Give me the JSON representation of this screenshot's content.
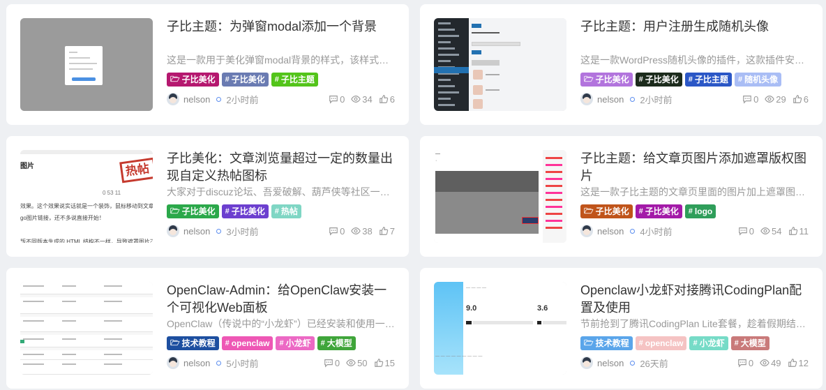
{
  "cards": [
    {
      "title": "子比主题：为弹窗modal添加一个背景",
      "excerpt": "这是一款用于美化弹窗modal背景的样式，该样式可以让弹窗更加美观。",
      "tags": [
        {
          "label": "子比美化",
          "color": "#b5186f",
          "icon": "folder-icon"
        },
        {
          "label": "子比美化",
          "color": "#6a7bb2",
          "icon": "hash-icon"
        },
        {
          "label": "子比主题",
          "color": "#53c41a",
          "icon": "hash-icon"
        }
      ],
      "author": "nelson",
      "time": "2小时前",
      "comments": "0",
      "views": "34",
      "likes": "6"
    },
    {
      "title": "子比主题：用户注册生成随机头像",
      "excerpt": "这是一款WordPress随机头像的插件，这款插件安装后用户注册时会随机分配头像。",
      "tags": [
        {
          "label": "子比美化",
          "color": "#b274dd",
          "icon": "folder-icon"
        },
        {
          "label": "子比美化",
          "color": "#1c2b1c",
          "icon": "hash-icon"
        },
        {
          "label": "子比主题",
          "color": "#2b57c6",
          "icon": "hash-icon"
        },
        {
          "label": "随机头像",
          "color": "#a9bdf5",
          "icon": "hash-icon"
        }
      ],
      "author": "nelson",
      "time": "2小时前",
      "comments": "0",
      "views": "29",
      "likes": "6"
    },
    {
      "title": "子比美化：文章浏览量超过一定的数量出现自定义热帖图标",
      "excerpt": "大家对于discuz论坛、吾爱破解、葫芦侠等社区一定都不陌生吧。",
      "tags": [
        {
          "label": "子比美化",
          "color": "#2ba84a",
          "icon": "folder-icon"
        },
        {
          "label": "子比美化",
          "color": "#6c3fcf",
          "icon": "hash-icon"
        },
        {
          "label": "热帖",
          "color": "#7fd6c4",
          "icon": "hash-icon"
        }
      ],
      "author": "nelson",
      "time": "3小时前",
      "comments": "0",
      "views": "38",
      "likes": "7"
    },
    {
      "title": "子比主题：给文章页图片添加遮罩版权图片",
      "excerpt": "这是一款子比主题的文章页里面的图片加上遮罩图片的效果。",
      "tags": [
        {
          "label": "子比美化",
          "color": "#c0541a",
          "icon": "folder-icon"
        },
        {
          "label": "子比美化",
          "color": "#a31aa8",
          "icon": "hash-icon"
        },
        {
          "label": "logo",
          "color": "#2f9e5a",
          "icon": "hash-icon"
        }
      ],
      "author": "nelson",
      "time": "4小时前",
      "comments": "0",
      "views": "54",
      "likes": "11"
    },
    {
      "title": "OpenClaw-Admin：给OpenClaw安装一个可视化Web面板",
      "excerpt": "OpenClaw（传说中的“小龙虾”）已经安装和使用一段时间了。",
      "tags": [
        {
          "label": "技术教程",
          "color": "#1d4fa0",
          "icon": "folder-icon"
        },
        {
          "label": "openclaw",
          "color": "#ee57b5",
          "icon": "hash-icon"
        },
        {
          "label": "小龙虾",
          "color": "#ec69c4",
          "icon": "hash-icon"
        },
        {
          "label": "大模型",
          "color": "#3fa53a",
          "icon": "hash-icon"
        }
      ],
      "author": "nelson",
      "time": "5小时前",
      "comments": "0",
      "views": "50",
      "likes": "15"
    },
    {
      "title": "Openclaw小龙虾对接腾讯CodingPlan配置及使用",
      "excerpt": "节前抢到了腾讯CodingPlan Lite套餐，趁着假期结束前配置一下。",
      "tags": [
        {
          "label": "技术教程",
          "color": "#5aa5ea",
          "icon": "folder-icon"
        },
        {
          "label": "openclaw",
          "color": "#f5c3c3",
          "icon": "hash-icon"
        },
        {
          "label": "小龙虾",
          "color": "#76dbc7",
          "icon": "hash-icon"
        },
        {
          "label": "大模型",
          "color": "#c97a7a",
          "icon": "hash-icon"
        }
      ],
      "author": "nelson",
      "time": "26天前",
      "comments": "0",
      "views": "49",
      "likes": "12"
    }
  ],
  "thumbs": {
    "t3": {
      "heading": "图片",
      "stamp": "热帖",
      "counts": "0 53 11",
      "lines": [
        "效果。这个效果说实话就是一个装饰，鼠标移动到文章中",
        "go图片链接，还不多说直接开始！",
        "",
        "版不同版本生成的 HTML 结构不一样，导致遮罩图片不生"
      ]
    },
    "t6": {
      "num1": "9.0",
      "num2": "3.6"
    }
  }
}
